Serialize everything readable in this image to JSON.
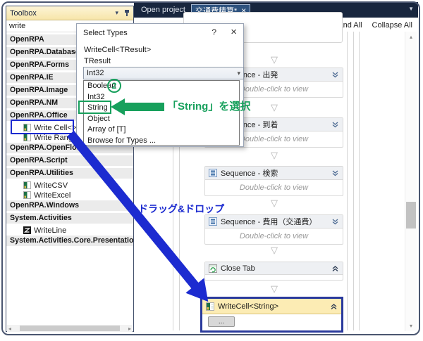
{
  "topbar": {
    "inactive_tab": "Open project",
    "active_tab": "交通費精算*",
    "active_tab_close": "×"
  },
  "toolbox": {
    "title": "Toolbox",
    "search_value": "write",
    "rows": [
      {
        "kind": "category",
        "label": "OpenRPA"
      },
      {
        "kind": "category",
        "label": "OpenRPA.Database"
      },
      {
        "kind": "category",
        "label": "OpenRPA.Forms"
      },
      {
        "kind": "category",
        "label": "OpenRPA.IE"
      },
      {
        "kind": "category",
        "label": "OpenRPA.Image"
      },
      {
        "kind": "category",
        "label": "OpenRPA.NM"
      },
      {
        "kind": "category",
        "label": "OpenRPA.Office"
      },
      {
        "kind": "item",
        "label": "Write Cell<>"
      },
      {
        "kind": "item",
        "label": "Write Range"
      },
      {
        "kind": "category",
        "label": "OpenRPA.OpenFlow"
      },
      {
        "kind": "category",
        "label": "OpenRPA.Script"
      },
      {
        "kind": "category",
        "label": "OpenRPA.Utilities"
      },
      {
        "kind": "item",
        "label": "WriteCSV"
      },
      {
        "kind": "item",
        "label": "WriteExcel"
      },
      {
        "kind": "category",
        "label": "OpenRPA.Windows"
      },
      {
        "kind": "category",
        "label": "System.Activities"
      },
      {
        "kind": "item",
        "label": "WriteLine"
      },
      {
        "kind": "category",
        "label": "System.Activities.Core.Presentation"
      }
    ]
  },
  "dialog": {
    "title": "Select Types",
    "help": "?",
    "close": "×",
    "generic_type": "WriteCell<TResult>",
    "type_param": "TResult",
    "selected_type": "Int32",
    "options": [
      "Boolean",
      "Int32",
      "String",
      "Object",
      "Array of [T]",
      "Browse for Types ..."
    ]
  },
  "designer": {
    "expand_all": "Expand All",
    "collapse_all": "Collapse All",
    "sequences": [
      {
        "label": "Sequence - 出発",
        "hint": "Double-click to view"
      },
      {
        "label": "Sequence - 到着",
        "hint": "Double-click to view"
      },
      {
        "label": "Sequence - 検索",
        "hint": "Double-click to view"
      },
      {
        "label": "Sequence - 費用（交通費）",
        "hint": "Double-click to view"
      }
    ],
    "close_tab_label": "Close Tab",
    "writecell_label": "WriteCell<String>",
    "writecell_button": "..."
  },
  "annotations": {
    "step": "2",
    "select_string_text": "「String」を選択",
    "drag_drop_text": "ドラッグ&ドロップ"
  },
  "colors": {
    "annotation_green": "#17a05c",
    "annotation_blue": "#1c2bd0",
    "topbar_navy": "#18263e",
    "active_tab_blue": "#2e527e",
    "activity_header_yellow": "#fcecb4",
    "selection_border_blue": "#2a3a9c"
  }
}
